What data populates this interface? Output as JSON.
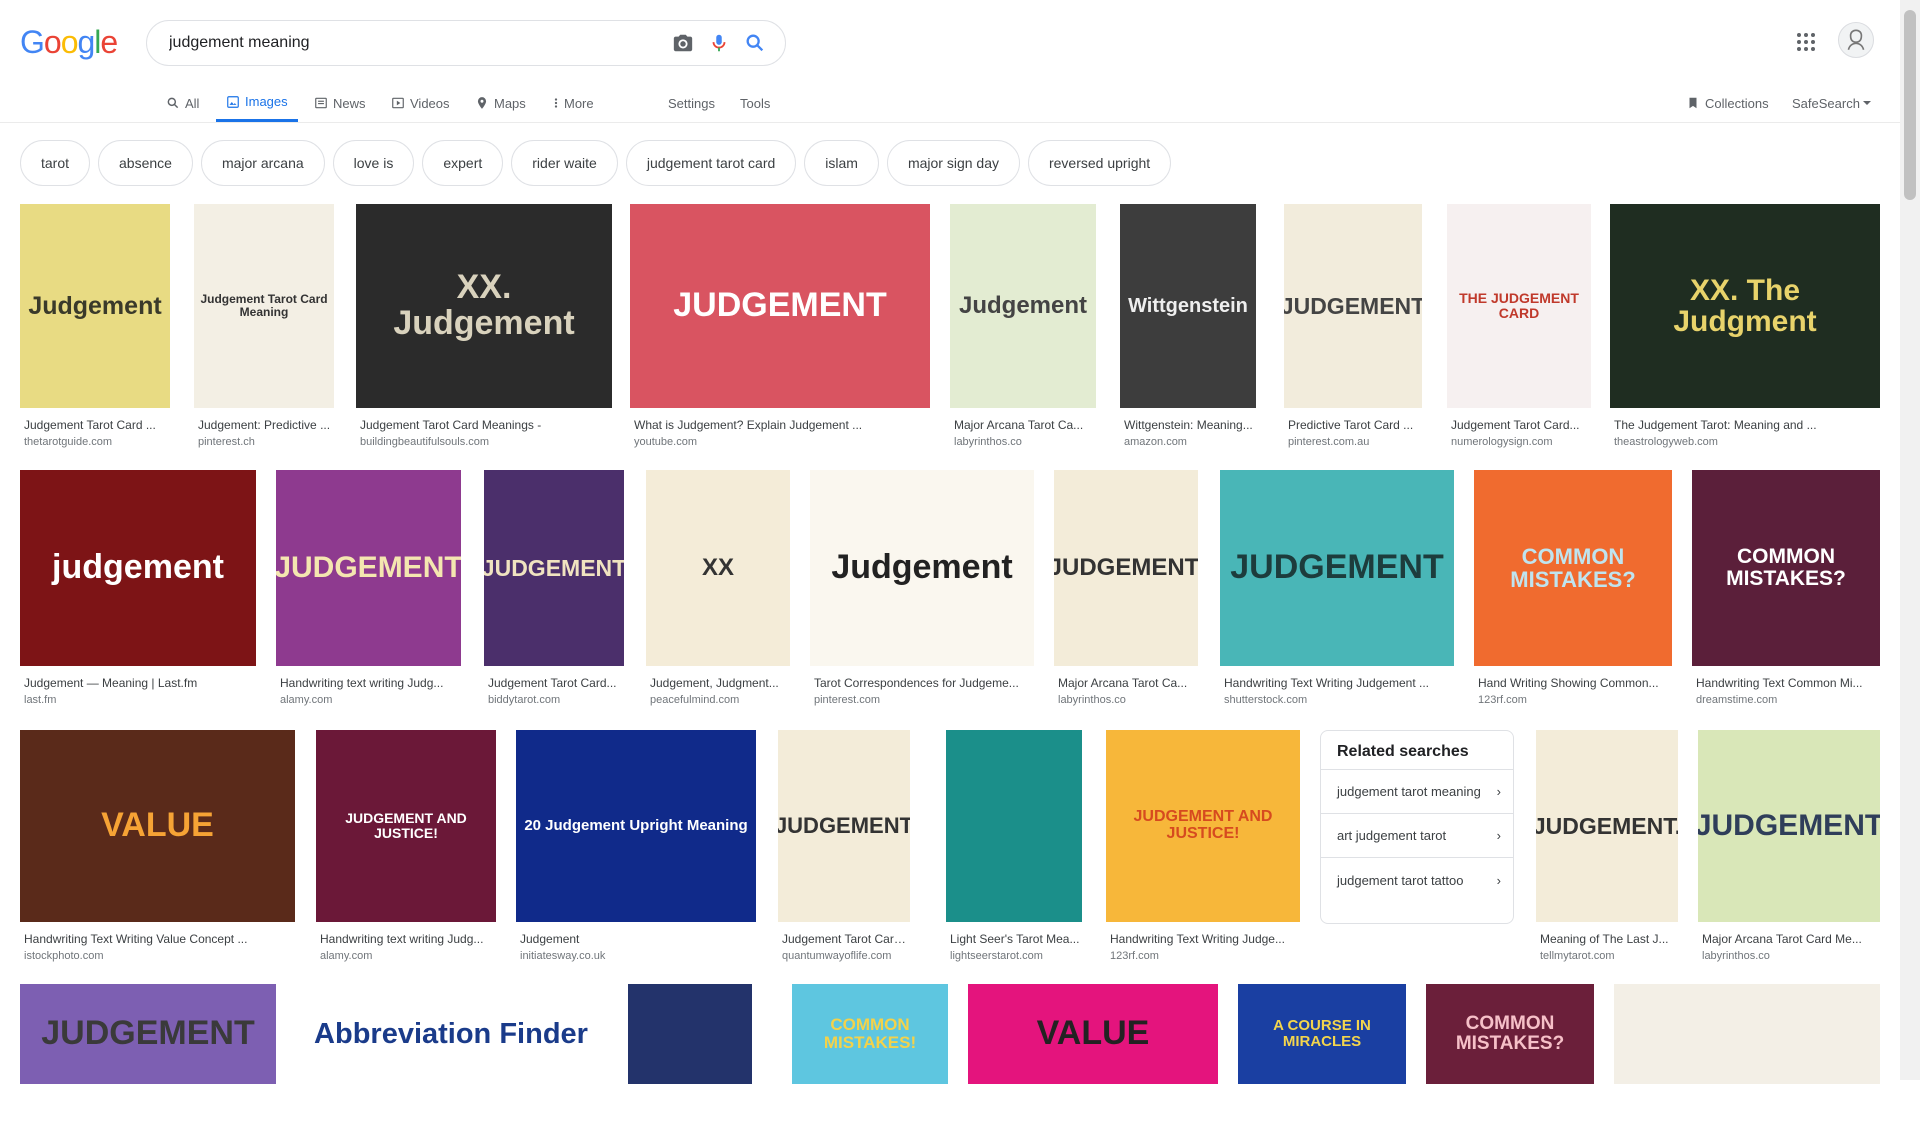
{
  "logo": "Google",
  "search": {
    "value": "judgement meaning"
  },
  "tabs": [
    "All",
    "Images",
    "News",
    "Videos",
    "Maps",
    "More"
  ],
  "tools": {
    "settings": "Settings",
    "tools": "Tools"
  },
  "right_tools": {
    "collections": "Collections",
    "safesearch": "SafeSearch"
  },
  "chips": [
    "tarot",
    "absence",
    "major arcana",
    "love is",
    "expert",
    "rider waite",
    "judgement tarot card",
    "islam",
    "major sign day",
    "reversed upright"
  ],
  "images": [
    {
      "title": "Judgement Tarot Card ...",
      "source": "thetarotguide.com",
      "thumb_text": "Judgement",
      "bg": "#e8db83",
      "fg": "#3a3a2a"
    },
    {
      "title": "Judgement: Predictive ...",
      "source": "pinterest.ch",
      "thumb_text": "Judgement Tarot Card Meaning",
      "bg": "#f3efe4",
      "fg": "#333"
    },
    {
      "title": "Judgement Tarot Card Meanings -",
      "source": "buildingbeautifulsouls.com",
      "thumb_text": "XX. Judgement",
      "bg": "#2b2b2b",
      "fg": "#d9d2bd"
    },
    {
      "title": "What is Judgement? Explain Judgement ...",
      "source": "youtube.com",
      "thumb_text": "JUDGEMENT",
      "bg": "#d95461",
      "fg": "#fff"
    },
    {
      "title": "Major Arcana Tarot Ca...",
      "source": "labyrinthos.co",
      "thumb_text": "Judgement",
      "bg": "#e3ecd2",
      "fg": "#444"
    },
    {
      "title": "Wittgenstein: Meaning...",
      "source": "amazon.com",
      "thumb_text": "Wittgenstein",
      "bg": "#3d3d3d",
      "fg": "#eee"
    },
    {
      "title": "Predictive Tarot Card ...",
      "source": "pinterest.com.au",
      "thumb_text": "JUDGEMENT",
      "bg": "#f2ecdc",
      "fg": "#444"
    },
    {
      "title": "Judgement Tarot Card...",
      "source": "numerologysign.com",
      "thumb_text": "THE JUDGEMENT CARD",
      "bg": "#f6f0f0",
      "fg": "#c0392b"
    },
    {
      "title": "The Judgement Tarot: Meaning and ...",
      "source": "theastrologyweb.com",
      "thumb_text": "XX. The Judgment",
      "bg": "#1f2d21",
      "fg": "#e8d36b"
    },
    {
      "title": "Judgement — Meaning | Last.fm",
      "source": "last.fm",
      "thumb_text": "judgement",
      "bg": "#7d1416",
      "fg": "#fff"
    },
    {
      "title": "Handwriting text writing Judg...",
      "source": "alamy.com",
      "thumb_text": "JUDGEMENT",
      "bg": "#8e3a8f",
      "fg": "#f4e6b0"
    },
    {
      "title": "Judgement Tarot Card...",
      "source": "biddytarot.com",
      "thumb_text": "JUDGEMENT",
      "bg": "#4b2f6b",
      "fg": "#f0e3c0"
    },
    {
      "title": "Judgement, Judgment...",
      "source": "peacefulmind.com",
      "thumb_text": "XX",
      "bg": "#f4ecd8",
      "fg": "#333"
    },
    {
      "title": "Tarot Correspondences for Judgeme...",
      "source": "pinterest.com",
      "thumb_text": "Judgement",
      "bg": "#faf7ef",
      "fg": "#222"
    },
    {
      "title": "Major Arcana Tarot Ca...",
      "source": "labyrinthos.co",
      "thumb_text": "JUDGEMENT.",
      "bg": "#f3ecd9",
      "fg": "#333"
    },
    {
      "title": "Handwriting Text Writing Judgement ...",
      "source": "shutterstock.com",
      "thumb_text": "JUDGEMENT",
      "bg": "#49b6b7",
      "fg": "#1d3c3c"
    },
    {
      "title": "Hand Writing Showing Common...",
      "source": "123rf.com",
      "thumb_text": "COMMON MISTAKES?",
      "bg": "#f06b2f",
      "fg": "#bfe4ef"
    },
    {
      "title": "Handwriting Text Common Mi...",
      "source": "dreamstime.com",
      "thumb_text": "COMMON MISTAKES?",
      "bg": "#5b1f3a",
      "fg": "#fff"
    },
    {
      "title": "Handwriting Text Writing Value Concept ...",
      "source": "istockphoto.com",
      "thumb_text": "VALUE",
      "bg": "#5a2a1a",
      "fg": "#f6a335"
    },
    {
      "title": "Handwriting text writing Judg...",
      "source": "alamy.com",
      "thumb_text": "JUDGEMENT AND JUSTICE!",
      "bg": "#6b1838",
      "fg": "#fff"
    },
    {
      "title": "Judgement",
      "source": "initiatesway.co.uk",
      "thumb_text": "20 Judgement Upright Meaning",
      "bg": "#102a8a",
      "fg": "#fff"
    },
    {
      "title": "Judgement Tarot Card...",
      "source": "quantumwayoflife.com",
      "thumb_text": "JUDGEMENT",
      "bg": "#f3ecd9",
      "fg": "#333"
    },
    {
      "title": "Light Seer's Tarot Mea...",
      "source": "lightseerstarot.com",
      "thumb_text": "",
      "bg": "#1b8f8a",
      "fg": "#fff"
    },
    {
      "title": "Handwriting Text Writing Judge...",
      "source": "123rf.com",
      "thumb_text": "JUDGEMENT AND JUSTICE!",
      "bg": "#f7b73a",
      "fg": "#d64a1f"
    },
    {
      "title": "Meaning of The Last J...",
      "source": "tellmytarot.com",
      "thumb_text": "JUDGEMENT.",
      "bg": "#f3ecd9",
      "fg": "#333"
    },
    {
      "title": "Major Arcana Tarot Card Me...",
      "source": "labyrinthos.co",
      "thumb_text": "JUDGEMENT",
      "bg": "#d9e7b8",
      "fg": "#2f3e5a"
    },
    {
      "title": "",
      "source": "",
      "thumb_text": "JUDGEMENT",
      "bg": "#7d5fb2",
      "fg": "#3a3a3a"
    },
    {
      "title": "",
      "source": "",
      "thumb_text": "Abbreviation Finder",
      "bg": "#ffffff",
      "fg": "#1a3b8a"
    },
    {
      "title": "",
      "source": "",
      "thumb_text": "",
      "bg": "#23336b",
      "fg": "#fff"
    },
    {
      "title": "",
      "source": "",
      "thumb_text": "COMMON MISTAKES!",
      "bg": "#5ec6e0",
      "fg": "#f4d24a"
    },
    {
      "title": "",
      "source": "",
      "thumb_text": "VALUE",
      "bg": "#e4147d",
      "fg": "#222"
    },
    {
      "title": "",
      "source": "",
      "thumb_text": "A COURSE IN MIRACLES",
      "bg": "#1a3fa2",
      "fg": "#f3d54d"
    },
    {
      "title": "",
      "source": "",
      "thumb_text": "COMMON MISTAKES?",
      "bg": "#6b1f3a",
      "fg": "#f6c0c8"
    },
    {
      "title": "",
      "source": "",
      "thumb_text": "",
      "bg": "#f3efe6",
      "fg": "#333"
    }
  ],
  "related": {
    "heading": "Related searches",
    "items": [
      "judgement tarot meaning",
      "art judgement tarot",
      "judgement tarot tattoo"
    ]
  }
}
